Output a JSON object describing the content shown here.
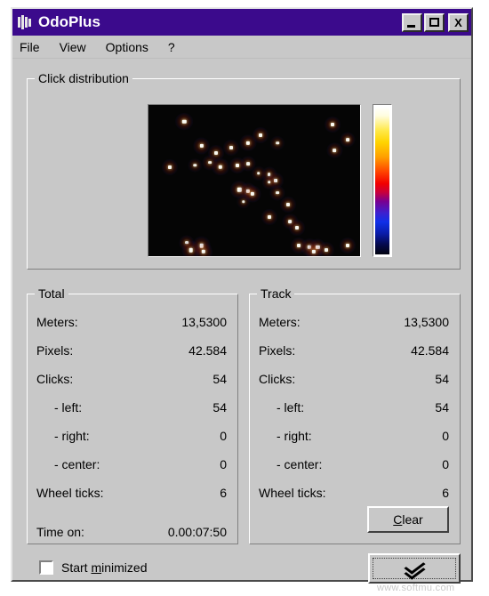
{
  "window": {
    "title": "OdoPlus",
    "icon": "app-grid-icon",
    "buttons": {
      "minimize": "minimize-icon",
      "maximize": "maximize-icon",
      "close": "X"
    }
  },
  "menu": {
    "items": [
      {
        "label": "File"
      },
      {
        "label": "View"
      },
      {
        "label": "Options"
      },
      {
        "label": "?"
      }
    ]
  },
  "click_distribution": {
    "title": "Click distribution",
    "colorbar": {
      "top_color": "#ffffff",
      "mid_color": "#ff0000",
      "bottom_color": "#02030f"
    }
  },
  "total": {
    "title": "Total",
    "rows": [
      {
        "label": "Meters:",
        "value": "13,5300",
        "indent": false
      },
      {
        "label": "Pixels:",
        "value": "42.584",
        "indent": false
      },
      {
        "label": "Clicks:",
        "value": "54",
        "indent": false
      },
      {
        "label": "- left:",
        "value": "54",
        "indent": true
      },
      {
        "label": "- right:",
        "value": "0",
        "indent": true
      },
      {
        "label": "- center:",
        "value": "0",
        "indent": true
      },
      {
        "label": "Wheel ticks:",
        "value": "6",
        "indent": false
      },
      {
        "label": "Time on:",
        "value": "0.00:07:50",
        "indent": false
      }
    ]
  },
  "track": {
    "title": "Track",
    "rows": [
      {
        "label": "Meters:",
        "value": "13,5300",
        "indent": false
      },
      {
        "label": "Pixels:",
        "value": "42.584",
        "indent": false
      },
      {
        "label": "Clicks:",
        "value": "54",
        "indent": false
      },
      {
        "label": "- left:",
        "value": "54",
        "indent": true
      },
      {
        "label": "- right:",
        "value": "0",
        "indent": true
      },
      {
        "label": "- center:",
        "value": "0",
        "indent": true
      },
      {
        "label": "Wheel ticks:",
        "value": "6",
        "indent": false
      }
    ],
    "clear_button": {
      "accel": "C",
      "rest": "lear"
    }
  },
  "footer": {
    "start_minimized": {
      "pre": "Start ",
      "accel": "m",
      "post": "inimized",
      "checked": false
    },
    "expand_button": "chevron-double-down-icon"
  },
  "watermark": "www.softmu.com",
  "chart_data": {
    "type": "scatter",
    "title": "Click distribution",
    "xlabel": "",
    "ylabel": "",
    "xlim": [
      0,
      100
    ],
    "ylim": [
      0,
      100
    ],
    "grid": false,
    "legend": null,
    "colormap": "hot-jet",
    "background": "#050505",
    "note": "Screen click heatmap; each point is a click location, brightness = click density",
    "points": [
      {
        "x": 17,
        "y": 11,
        "i": 0.95,
        "r": 2.2
      },
      {
        "x": 53,
        "y": 20,
        "i": 0.9,
        "r": 2.0
      },
      {
        "x": 87,
        "y": 13,
        "i": 0.92,
        "r": 2.0
      },
      {
        "x": 94,
        "y": 23,
        "i": 0.88,
        "r": 1.9
      },
      {
        "x": 88,
        "y": 30,
        "i": 0.86,
        "r": 1.9
      },
      {
        "x": 25,
        "y": 27,
        "i": 0.92,
        "r": 2.1
      },
      {
        "x": 32,
        "y": 32,
        "i": 0.85,
        "r": 2.0
      },
      {
        "x": 39,
        "y": 28,
        "i": 0.8,
        "r": 2.0
      },
      {
        "x": 47,
        "y": 25,
        "i": 0.93,
        "r": 2.1
      },
      {
        "x": 61,
        "y": 25,
        "i": 0.7,
        "r": 1.8
      },
      {
        "x": 29,
        "y": 38,
        "i": 0.78,
        "r": 1.9
      },
      {
        "x": 22,
        "y": 40,
        "i": 0.7,
        "r": 1.7
      },
      {
        "x": 10,
        "y": 41,
        "i": 0.88,
        "r": 2.0
      },
      {
        "x": 34,
        "y": 41,
        "i": 0.95,
        "r": 2.2
      },
      {
        "x": 42,
        "y": 40,
        "i": 0.9,
        "r": 2.0
      },
      {
        "x": 47,
        "y": 39,
        "i": 0.82,
        "r": 1.9
      },
      {
        "x": 52,
        "y": 45,
        "i": 0.72,
        "r": 1.8
      },
      {
        "x": 57,
        "y": 46,
        "i": 0.8,
        "r": 1.9
      },
      {
        "x": 60,
        "y": 50,
        "i": 0.84,
        "r": 2.0
      },
      {
        "x": 57,
        "y": 51,
        "i": 0.75,
        "r": 1.8
      },
      {
        "x": 43,
        "y": 56,
        "i": 0.92,
        "r": 2.2
      },
      {
        "x": 47,
        "y": 57,
        "i": 0.88,
        "r": 2.1
      },
      {
        "x": 49,
        "y": 59,
        "i": 0.9,
        "r": 2.1
      },
      {
        "x": 61,
        "y": 58,
        "i": 0.78,
        "r": 1.9
      },
      {
        "x": 45,
        "y": 64,
        "i": 0.65,
        "r": 1.7
      },
      {
        "x": 66,
        "y": 66,
        "i": 0.86,
        "r": 2.0
      },
      {
        "x": 57,
        "y": 74,
        "i": 0.88,
        "r": 2.0
      },
      {
        "x": 67,
        "y": 77,
        "i": 0.84,
        "r": 1.9
      },
      {
        "x": 70,
        "y": 81,
        "i": 0.86,
        "r": 2.0
      },
      {
        "x": 18,
        "y": 91,
        "i": 0.82,
        "r": 1.9
      },
      {
        "x": 25,
        "y": 93,
        "i": 0.95,
        "r": 2.3
      },
      {
        "x": 20,
        "y": 96,
        "i": 0.93,
        "r": 2.3
      },
      {
        "x": 26,
        "y": 97,
        "i": 0.9,
        "r": 2.2
      },
      {
        "x": 71,
        "y": 93,
        "i": 0.86,
        "r": 2.0
      },
      {
        "x": 76,
        "y": 94,
        "i": 0.92,
        "r": 2.2
      },
      {
        "x": 80,
        "y": 94,
        "i": 0.88,
        "r": 2.1
      },
      {
        "x": 78,
        "y": 97,
        "i": 0.85,
        "r": 2.1
      },
      {
        "x": 84,
        "y": 96,
        "i": 0.8,
        "r": 2.0
      },
      {
        "x": 94,
        "y": 93,
        "i": 0.9,
        "r": 2.0
      }
    ]
  }
}
